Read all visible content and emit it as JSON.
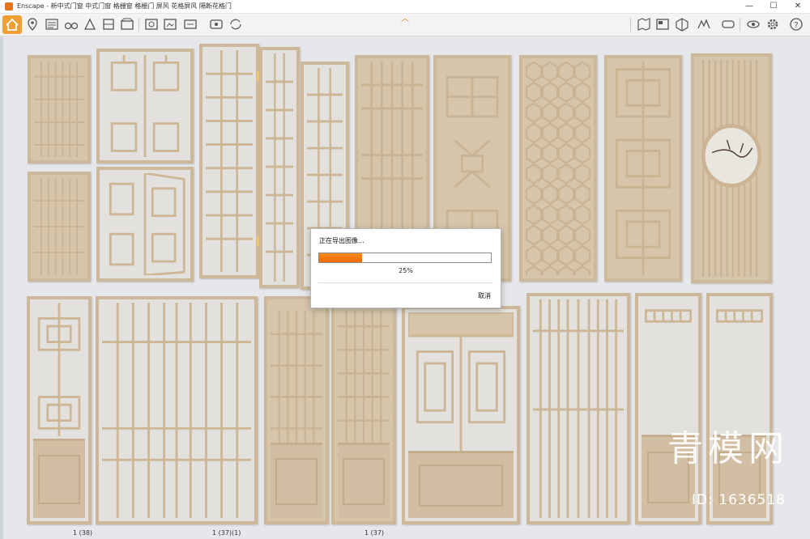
{
  "window": {
    "title": "Enscape - 新中式门窗 中式门窗 格栅窗 格栅门 屏风 花格屏风 隔断花格门",
    "minimize": "—",
    "maximize": "☐",
    "close": "✕"
  },
  "toolbar": {
    "left_icons": [
      "home-icon",
      "location-pin-icon",
      "bim-info-icon",
      "binoculars-icon",
      "walk-mode-icon",
      "fly-mode-icon",
      "asset-library-icon",
      "video-editor-icon",
      "export-screenshot-icon",
      "batch-render-icon",
      "export-exe-icon",
      "export-panorama-icon",
      "sketchup-sync-icon"
    ],
    "right_icons": [
      "map-icon",
      "view-management-icon",
      "cube-icon",
      "atmosphere-icon",
      "vr-headset-icon",
      "visual-settings-icon",
      "gear-icon",
      "help-icon"
    ],
    "accent_color": "#f0a030"
  },
  "dialog": {
    "title": "正在导出图像...",
    "progress": 0.25,
    "progress_label": "25%",
    "cancel_label": "取消"
  },
  "watermark": {
    "text": "青模网",
    "id_text": "ID: 1636518"
  },
  "bottom_labels": [
    "1 (38)",
    "1 (37)(1)",
    "1 (37)"
  ],
  "colors": {
    "viewport_bg": "#e6e7ea",
    "wood": "#d7c5ab",
    "wood_frame": "#cdb89a",
    "progress_orange": "#f06a00"
  }
}
